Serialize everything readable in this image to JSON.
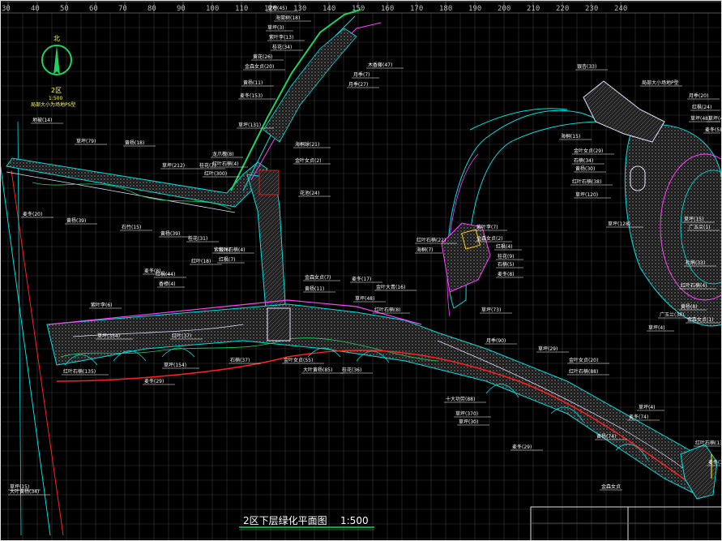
{
  "ruler": {
    "ticks": [
      "30",
      "40",
      "50",
      "60",
      "70",
      "80",
      "90",
      "100",
      "110",
      "120",
      "130",
      "140",
      "150",
      "160",
      "170",
      "180",
      "190",
      "200",
      "210",
      "220",
      "230",
      "240"
    ]
  },
  "north": {
    "label": "北",
    "zone": "2区",
    "scale": "1:500",
    "caption": "局部大小为场地PS型"
  },
  "title": {
    "text": "2区下层绿化平面图",
    "scale": "1:500"
  },
  "colors": {
    "grid": "#3a3a3a",
    "road": "#ff2020",
    "edge": "#00e0e0",
    "path": "#e0e0ff",
    "green": "#20d060",
    "magenta": "#ff40ff",
    "hatch": "#8a8a8a",
    "leader": "#ffffff",
    "accent": "#ffcc00",
    "yellow": "#ffff00"
  },
  "labels": [
    {
      "text": "草坪(45)"
    },
    {
      "text": "海棠树(18)"
    },
    {
      "text": "草坪(3)"
    },
    {
      "text": "紫叶李(13)"
    },
    {
      "text": "桂花(34)"
    },
    {
      "text": "黄花(26)"
    },
    {
      "text": "金森女贞(20)"
    },
    {
      "text": "黄杨(11)"
    },
    {
      "text": "麦冬(153)"
    },
    {
      "text": "草坪(131)"
    },
    {
      "text": "龙爪槐(8)"
    },
    {
      "text": "木香藤(47)"
    },
    {
      "text": "月季(7)"
    },
    {
      "text": "月季(27)"
    },
    {
      "text": "海桐球(21)"
    },
    {
      "text": "金叶女贞(2)"
    },
    {
      "text": "红叶石楠(4)"
    },
    {
      "text": "花池(24)"
    },
    {
      "text": "红叶(300)"
    },
    {
      "text": "桂花(7)"
    },
    {
      "text": "地被(14)"
    },
    {
      "text": "草坪(79)"
    },
    {
      "text": "黄杨(18)"
    },
    {
      "text": "草坪(212)"
    },
    {
      "text": "麦冬(20)"
    },
    {
      "text": "黄杨(39)"
    },
    {
      "text": "石竹(15)"
    },
    {
      "text": "黄杨(39)"
    },
    {
      "text": "桂花(31)"
    },
    {
      "text": "紫薇(6)"
    },
    {
      "text": "红枫(44)"
    },
    {
      "text": "香樟(4)"
    },
    {
      "text": "银杏(33)"
    },
    {
      "text": "海桐(15)"
    },
    {
      "text": "金叶女贞(29)"
    },
    {
      "text": "石楠(34)"
    },
    {
      "text": "黄杨(30)"
    },
    {
      "text": "红叶石楠(38)"
    },
    {
      "text": "草坪(120)"
    },
    {
      "text": "局部大小场地P型"
    },
    {
      "text": "月季(20)"
    },
    {
      "text": "红枫(24)"
    },
    {
      "text": "草坪(48)"
    },
    {
      "text": "麦冬(5)"
    },
    {
      "text": "草坪(4)"
    },
    {
      "text": "广玉兰(1)"
    },
    {
      "text": "草坪(128)"
    },
    {
      "text": "紫叶李(7)"
    },
    {
      "text": "金森女贞(2)"
    },
    {
      "text": "红枫(4)"
    },
    {
      "text": "桂花(9)"
    },
    {
      "text": "石楠(5)"
    },
    {
      "text": "草坪(73)"
    },
    {
      "text": "红叶石楠(22)"
    },
    {
      "text": "海桐(7)"
    },
    {
      "text": "麦冬(8)"
    },
    {
      "text": "黄杨(8)"
    },
    {
      "text": "草坪(4)"
    },
    {
      "text": "金森女贞(1)"
    },
    {
      "text": "红叶石楠(4)"
    },
    {
      "text": "杜鹃(33)"
    },
    {
      "text": "草坪(15)"
    },
    {
      "text": "广玉兰(38)"
    },
    {
      "text": "红叶石楠(4)"
    },
    {
      "text": "红枫(7)"
    },
    {
      "text": "红叶(18)"
    },
    {
      "text": "金森女贞(7)"
    },
    {
      "text": "黄杨(11)"
    },
    {
      "text": "麦冬(17)"
    },
    {
      "text": "草坪(48)"
    },
    {
      "text": "金叶大青(16)"
    },
    {
      "text": "红叶石楠(8)"
    },
    {
      "text": "麦冬(8)"
    },
    {
      "text": "紫叶李(6)"
    },
    {
      "text": "草坪(354)"
    },
    {
      "text": "草坪(154)"
    },
    {
      "text": "红叶(37)"
    },
    {
      "text": "石楠(37)"
    },
    {
      "text": "金叶女贞(55)"
    },
    {
      "text": "大叶黄杨(85)"
    },
    {
      "text": "桂花(36)"
    },
    {
      "text": "红叶石楠(135)"
    },
    {
      "text": "麦冬(29)"
    },
    {
      "text": "十大功劳(88)"
    },
    {
      "text": "月季(90)"
    },
    {
      "text": "草坪(29)"
    },
    {
      "text": "金叶女贞(20)"
    },
    {
      "text": "红叶石楠(88)"
    },
    {
      "text": "麦冬(74)"
    },
    {
      "text": "黄杨(74)"
    },
    {
      "text": "草坪(370)"
    },
    {
      "text": "草坪(30)"
    },
    {
      "text": "麦冬(29)"
    },
    {
      "text": "金森女贞"
    },
    {
      "text": "红叶石楠(130)"
    },
    {
      "text": "麦冬(39)"
    },
    {
      "text": "草坪(4)"
    },
    {
      "text": "草坪(15)"
    },
    {
      "text": "大叶黄杨(34)"
    }
  ]
}
